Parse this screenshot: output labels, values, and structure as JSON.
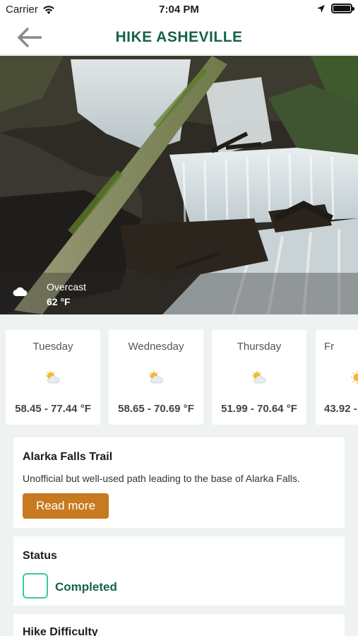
{
  "status_bar": {
    "carrier": "Carrier",
    "time": "7:04 PM"
  },
  "nav": {
    "title": "HIKE ASHEVILLE",
    "back_icon": "arrow-left-icon"
  },
  "hero": {
    "image": "waterfall-photo",
    "weather": {
      "condition": "Overcast",
      "temperature": "62 °F",
      "icon": "cloud-icon"
    }
  },
  "forecast": [
    {
      "day": "Tuesday",
      "range": "58.45 - 77.44 °F",
      "icon": "partly-sunny-icon"
    },
    {
      "day": "Wednesday",
      "range": "58.65 - 70.69 °F",
      "icon": "partly-sunny-icon"
    },
    {
      "day": "Thursday",
      "range": "51.99 - 70.64 °F",
      "icon": "partly-sunny-icon"
    },
    {
      "day": "Fr",
      "range": "43.92 -",
      "icon": "sunny-icon"
    }
  ],
  "trail": {
    "name": "Alarka Falls Trail",
    "description": "Unofficial but well-used path leading to the base of Alarka Falls.",
    "read_more_label": "Read more"
  },
  "status": {
    "title": "Status",
    "completed_label": "Completed",
    "completed": false
  },
  "difficulty": {
    "title": "Hike Difficulty"
  },
  "colors": {
    "brand_green": "#17624d",
    "accent_orange": "#c77a20",
    "checkbox_green": "#3ec890"
  }
}
